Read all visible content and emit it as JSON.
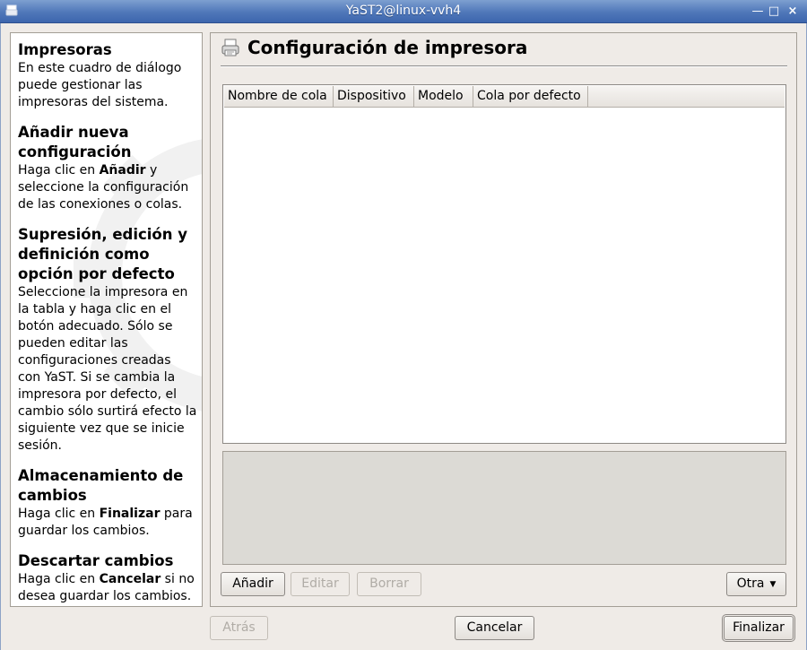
{
  "window": {
    "title": "YaST2@linux-vvh4"
  },
  "help": {
    "sections": [
      {
        "heading": "Impresoras",
        "text": "En este cuadro de diálogo puede gestionar las impresoras del sistema."
      },
      {
        "heading": "Añadir nueva configuración",
        "text_before": "Haga clic en ",
        "strong": "Añadir",
        "text_after": " y seleccione la configuración de las conexiones o colas."
      },
      {
        "heading": "Supresión, edición y definición como opción por defecto",
        "text": "Seleccione la impresora en la tabla y haga clic en el botón adecuado. Sólo se pueden editar las configuraciones creadas con YaST. Si se cambia la impresora por defecto, el cambio sólo surtirá efecto la siguiente vez que se inicie sesión."
      },
      {
        "heading": "Almacenamiento de cambios",
        "text_before": "Haga clic en ",
        "strong": "Finalizar",
        "text_after": " para guardar los cambios."
      },
      {
        "heading": "Descartar cambios",
        "text_before": "Haga clic en ",
        "strong": "Cancelar",
        "text_after": " si no desea guardar los cambios."
      }
    ]
  },
  "main": {
    "title": "Configuración de impresora",
    "icon": "printer-icon",
    "table": {
      "columns": [
        "Nombre de cola",
        "Dispositivo",
        "Modelo",
        "Cola por defecto"
      ],
      "rows": []
    },
    "buttons": {
      "add": "Añadir",
      "edit": "Editar",
      "delete": "Borrar",
      "other": "Otra"
    }
  },
  "footer": {
    "back": "Atrás",
    "cancel": "Cancelar",
    "finish": "Finalizar"
  }
}
